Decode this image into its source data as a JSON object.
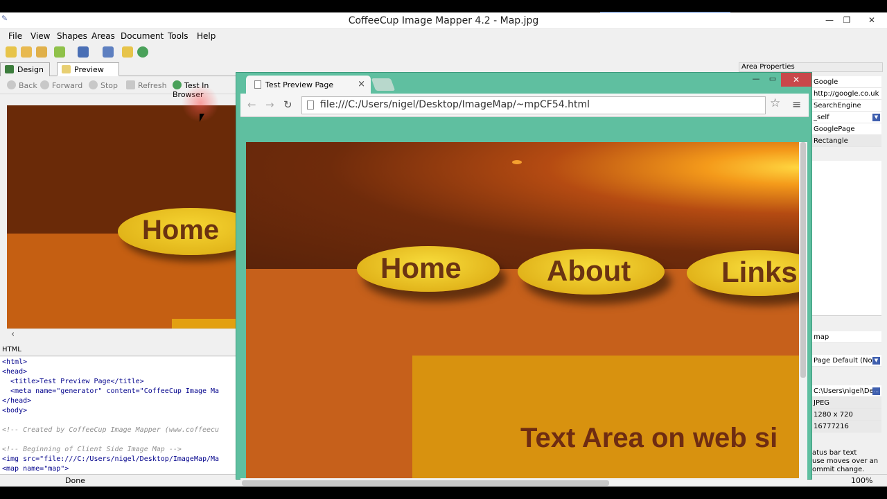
{
  "window": {
    "title": "CoffeeCup Image Mapper 4.2 - Map.jpg"
  },
  "menu": [
    "File",
    "View",
    "Shapes",
    "Areas",
    "Document",
    "Tools",
    "Help"
  ],
  "tabs": {
    "design": "Design",
    "preview": "Preview"
  },
  "nav": {
    "back": "Back",
    "forward": "Forward",
    "stop": "Stop",
    "refresh": "Refresh",
    "test": "Test In Browser"
  },
  "left_preview": {
    "home_label": "Home"
  },
  "code": {
    "header": "HTML",
    "lines": [
      "<html>",
      "<head>",
      "  <title>Test Preview Page</title>",
      "  <meta name=\"generator\" content=\"CoffeeCup Image Ma",
      "</head>",
      "<body>",
      "",
      "<!-- Created by CoffeeCup Image Mapper (www.coffeecu",
      "",
      "<!-- Beginning of Client Side Image Map -->",
      "<img src=\"file:///C:/Users/nigel/Desktop/ImageMap/Ma",
      "<map name=\"map\">"
    ]
  },
  "status": {
    "text": "Done",
    "zoom": "100%"
  },
  "properties": {
    "header": "Area Properties",
    "values": [
      "Google",
      "http://google.co.uk",
      "SearchEngine",
      "_self",
      "GooglePage",
      "Rectangle"
    ],
    "values2": [
      "map",
      "Page Default (Nor"
    ],
    "values3": [
      "C:\\Users\\nigel\\De",
      "JPEG",
      "1280 x 720",
      "16777216"
    ],
    "note": "atus bar text\nuse moves over an\nommit change."
  },
  "browser": {
    "tab_title": "Test Preview Page",
    "url": "file:///C:/Users/nigel/Desktop/ImageMap/~mpCF54.html",
    "buttons": [
      "Home",
      "About",
      "Links"
    ],
    "text_area": "Text Area on web si"
  }
}
